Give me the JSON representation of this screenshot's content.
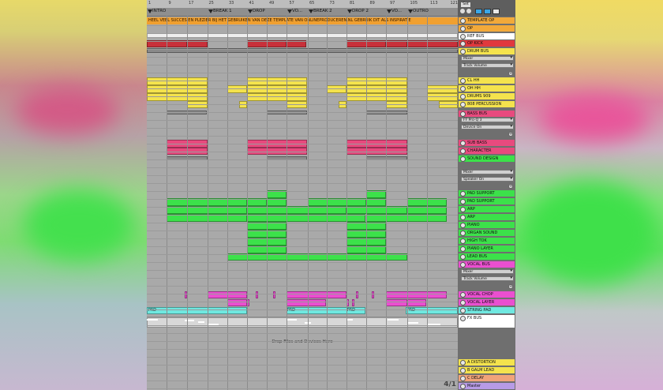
{
  "locators": [
    {
      "label": "INTRO"
    },
    {
      "label": "BREAK 1"
    },
    {
      "label": "DROP"
    },
    {
      "label": "VO..."
    },
    {
      "label": "BREAK 2"
    },
    {
      "label": "DROP 2"
    },
    {
      "label": "VO..."
    },
    {
      "label": "OUTRO"
    }
  ],
  "bar_numbers": [
    "1",
    "9",
    "17",
    "25",
    "33",
    "41",
    "49",
    "57",
    "65",
    "73",
    "81",
    "89",
    "97",
    "105",
    "113",
    "121"
  ],
  "intro_text": "HEEL VEEL SUCCES EN PLEZIER BIJ HET GEBRUIKEN VAN DEZE TEMPLATE VAN ONLINEPRODUCEREN.NL GEBRUIK DIT ALS INSPIRATIE",
  "clip_labels": [
    "PAD",
    "PAD",
    "PAD",
    "PAD"
  ],
  "drop_text": "Drop Files and Devices Here",
  "counter": "4/1",
  "header_button": "Set",
  "tracks": [
    {
      "name": "TEMPLATE OP",
      "color": "#f2a93a"
    },
    {
      "name": "OP",
      "color": "#f2a93a"
    },
    {
      "name": "REF BUS",
      "color": "#ffffff"
    },
    {
      "name": "OP KICK",
      "color": "#e0393e"
    },
    {
      "name": "DRUM BUS",
      "color": "#f4e34d"
    },
    {
      "name": "CL HH",
      "color": "#f4e34d"
    },
    {
      "name": "OH HH",
      "color": "#f4e34d"
    },
    {
      "name": "DRUMS 909",
      "color": "#f4e34d"
    },
    {
      "name": "808 PERCUSSION",
      "color": "#f4e34d"
    },
    {
      "name": "BASS BUS",
      "color": "#e84a7e"
    },
    {
      "name": "SUB BASS",
      "color": "#e84a7e"
    },
    {
      "name": "CHARACTER",
      "color": "#e84a7e"
    },
    {
      "name": "SOUND DESIGN",
      "color": "#3ce14a"
    },
    {
      "name": "PAD SUPPORT",
      "color": "#3ce14a"
    },
    {
      "name": "PAD SUPPORT",
      "color": "#3ce14a"
    },
    {
      "name": "ARP",
      "color": "#3ce14a"
    },
    {
      "name": "ARP",
      "color": "#3ce14a"
    },
    {
      "name": "PIANO",
      "color": "#3ce14a"
    },
    {
      "name": "ORGAN SOUND",
      "color": "#3ce14a"
    },
    {
      "name": "HIGH TOK",
      "color": "#3ce14a"
    },
    {
      "name": "PIANO LAYER",
      "color": "#3ce14a"
    },
    {
      "name": "LEAD BUS",
      "color": "#3ce14a"
    },
    {
      "name": "VOCAL BUS",
      "color": "#ea4fd0"
    },
    {
      "name": "VOCAL CHOP",
      "color": "#ea4fd0"
    },
    {
      "name": "VOCAL LAYER",
      "color": "#ea4fd0"
    },
    {
      "name": "STRING PAD",
      "color": "#6fe8e0"
    },
    {
      "name": "FX BUS",
      "color": "#ffffff"
    },
    {
      "name": "A DISTORTION",
      "color": "#f4e34d"
    },
    {
      "name": "B GALM LEAD",
      "color": "#f4e34d"
    },
    {
      "name": "C DELAY",
      "color": "#f0a37a"
    },
    {
      "name": "Master",
      "color": "#b79be6"
    }
  ],
  "selectors": {
    "drum_mixer": "Mixer",
    "drum_param": "Track Volume",
    "bass_device": "FF Pro-Q 3",
    "bass_param": "Device On",
    "sd_mixer": "Mixer",
    "sd_param": "Speaker On",
    "vocal_mixer": "Mixer",
    "vocal_param": "Track Volume"
  },
  "colors": {
    "yellow": "#f4e34d",
    "green": "#3ce14a",
    "pink": "#e84a7e",
    "magenta": "#ea4fd0",
    "cyan": "#6fe8e0",
    "red": "#c8303a",
    "orange": "#f0a030"
  }
}
